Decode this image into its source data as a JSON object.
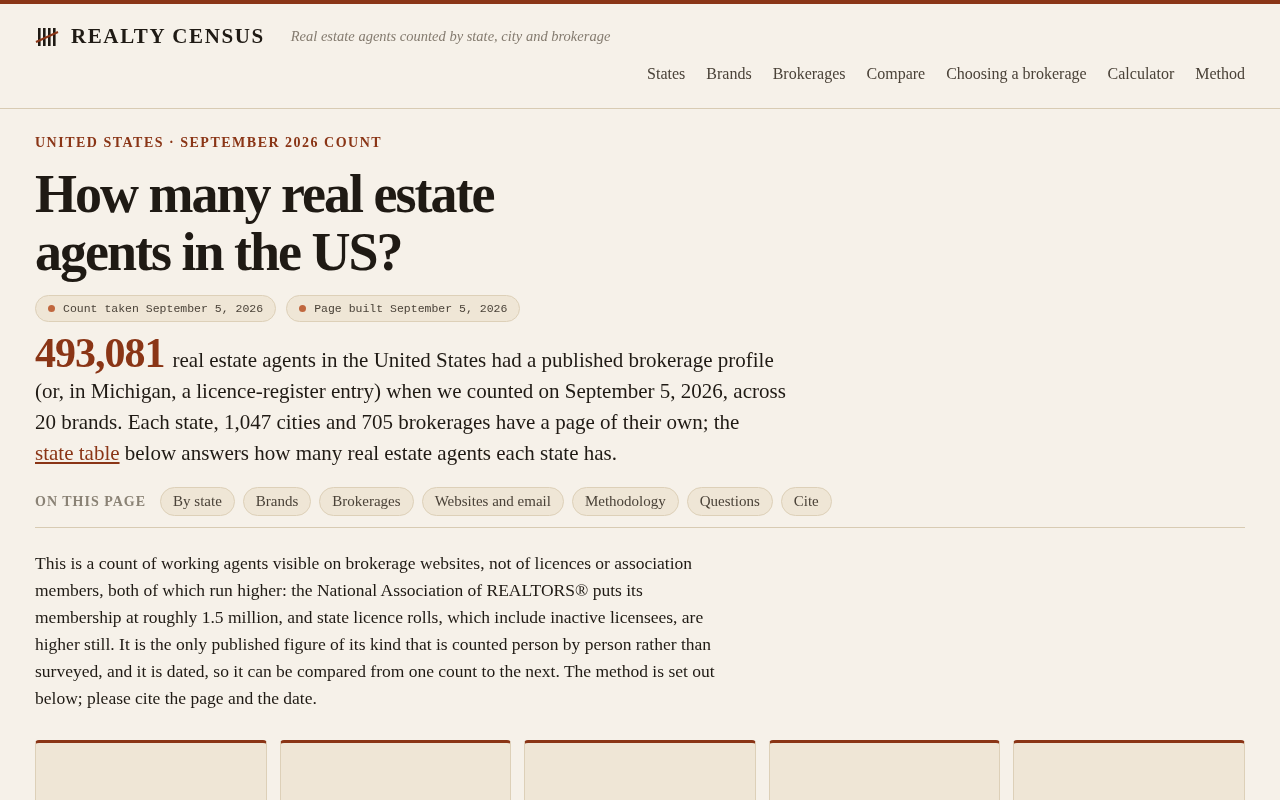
{
  "header": {
    "brand": "REALTY CENSUS",
    "tagline": "Real estate agents counted by state, city and brokerage",
    "nav": [
      "States",
      "Brands",
      "Brokerages",
      "Compare",
      "Choosing a brokerage",
      "Calculator",
      "Method"
    ]
  },
  "hero": {
    "eyebrow": "UNITED STATES · SEPTEMBER 2026 COUNT",
    "title": "How many real estate agents in the US?",
    "stamps": [
      {
        "text": "Count taken September 5, 2026",
        "color": "#c0673e"
      },
      {
        "text": "Page built September 5, 2026",
        "color": "#c0673e"
      }
    ],
    "figure": "493,081",
    "lead_before": "real estate agents in the United States had a published brokerage profile (or, in Michigan, a licence-register entry) when we counted on September 5, 2026, across 20 brands. Each state, 1,047 cities and 705 brokerages have a page of their own; the",
    "lead_link": "state table",
    "lead_after": "below answers how many real estate agents each state has."
  },
  "on_this_page": {
    "label": "ON THIS PAGE",
    "links": [
      "By state",
      "Brands",
      "Brokerages",
      "Websites and email",
      "Methodology",
      "Questions",
      "Cite"
    ]
  },
  "note": "This is a count of working agents visible on brokerage websites, not of licences or association members, both of which run higher: the National Association of REALTORS® puts its membership at roughly 1.5 million, and state licence rolls, which include inactive licensees, are higher still. It is the only published figure of its kind that is counted person by person rather than surveyed, and it is dated, so it can be compared from one count to the next. The method is set out below; please cite the page and the date.",
  "stat_cards": [
    {
      "kind": "card"
    },
    {
      "kind": "card"
    },
    {
      "kind": "card"
    },
    {
      "kind": "card"
    },
    {
      "kind": "card"
    }
  ]
}
